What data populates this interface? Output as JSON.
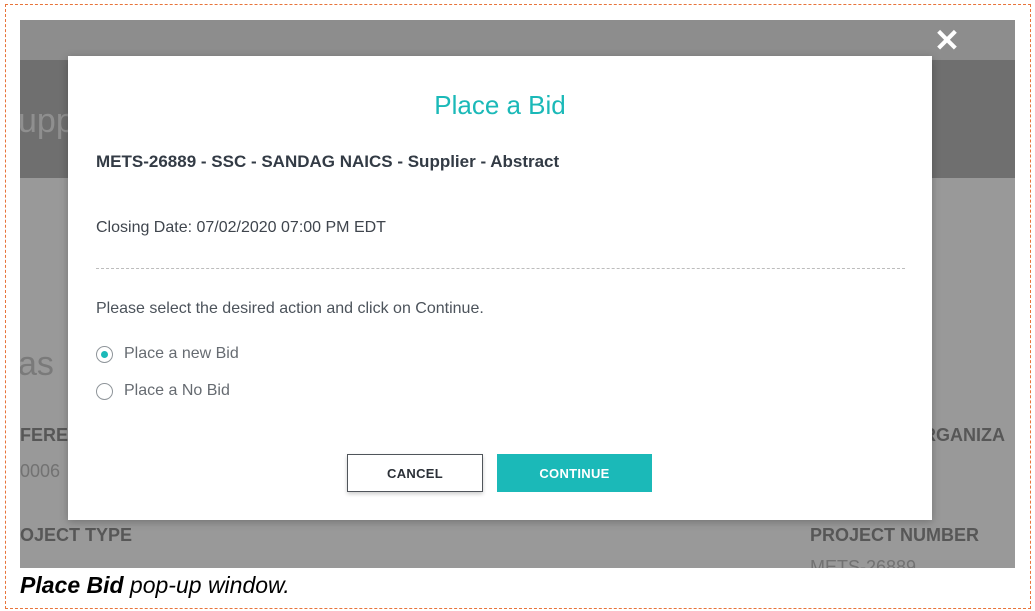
{
  "background": {
    "title_fragment": "upp",
    "heading_fragment": "as",
    "ref_label_fragment": "FERE",
    "ref_value_fragment": "0006",
    "org_label_fragment": "RGANIZA",
    "project_type_label": "OJECT TYPE",
    "project_number_label": "PROJECT NUMBER",
    "project_number_value_fragment": "METS-26889"
  },
  "modal": {
    "title": "Place a Bid",
    "project_title": "METS-26889 - SSC - SANDAG NAICS - Supplier - Abstract",
    "closing_date": "Closing Date: 07/02/2020 07:00 PM EDT",
    "instruction": "Please select the desired action and click on Continue.",
    "options": [
      {
        "label": "Place a new Bid",
        "selected": true
      },
      {
        "label": "Place a No Bid",
        "selected": false
      }
    ],
    "cancel_label": "CANCEL",
    "continue_label": "CONTINUE"
  },
  "caption": {
    "bold": "Place Bid",
    "rest": " pop-up window."
  },
  "colors": {
    "accent": "#1bb9b8",
    "frame_border": "#e8743b",
    "overlay": "#8d8d8d"
  },
  "icons": {
    "close": "close-icon",
    "radio": "radio-button-icon"
  }
}
